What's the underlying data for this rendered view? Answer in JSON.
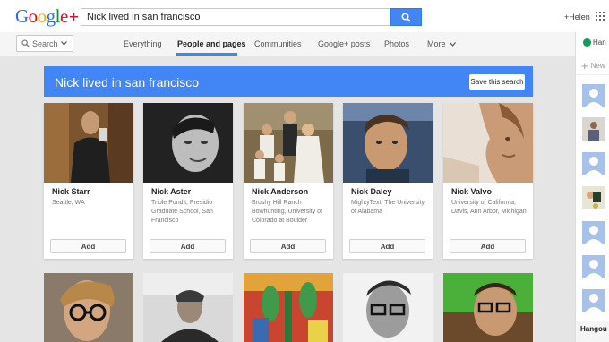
{
  "header": {
    "logo_text": "Google+",
    "search_value": "Nick lived in san francisco",
    "user_label": "+Helen"
  },
  "subnav": {
    "search_dropdown": "Search",
    "tabs": [
      {
        "label": "Everything"
      },
      {
        "label": "People and pages"
      },
      {
        "label": "Communities"
      },
      {
        "label": "Google+ posts"
      },
      {
        "label": "Photos"
      },
      {
        "label": "More"
      }
    ]
  },
  "banner": {
    "title": "Nick lived in san francisco",
    "save_label": "Save this search"
  },
  "people": [
    {
      "name": "Nick Starr",
      "description": "Seattle, WA",
      "add_label": "Add"
    },
    {
      "name": "Nick Aster",
      "description": "Triple Pundit, Presidio Graduate School, San Francisco",
      "add_label": "Add"
    },
    {
      "name": "Nick Anderson",
      "description": "Brushy Hill Ranch Bowhunting, University of Colorado at Boulder",
      "add_label": "Add"
    },
    {
      "name": "Nick Daley",
      "description": "MightyText, The University of Alabama",
      "add_label": "Add"
    },
    {
      "name": "Nick Valvo",
      "description": "University of California, Davis, Ann Arbor, Michigan",
      "add_label": "Add"
    }
  ],
  "sidebar": {
    "top_label": "Han",
    "new_label": "New",
    "bottom_label": "Hangou"
  },
  "colors": {
    "accent": "#4285f4",
    "background": "#e5e5e5"
  }
}
